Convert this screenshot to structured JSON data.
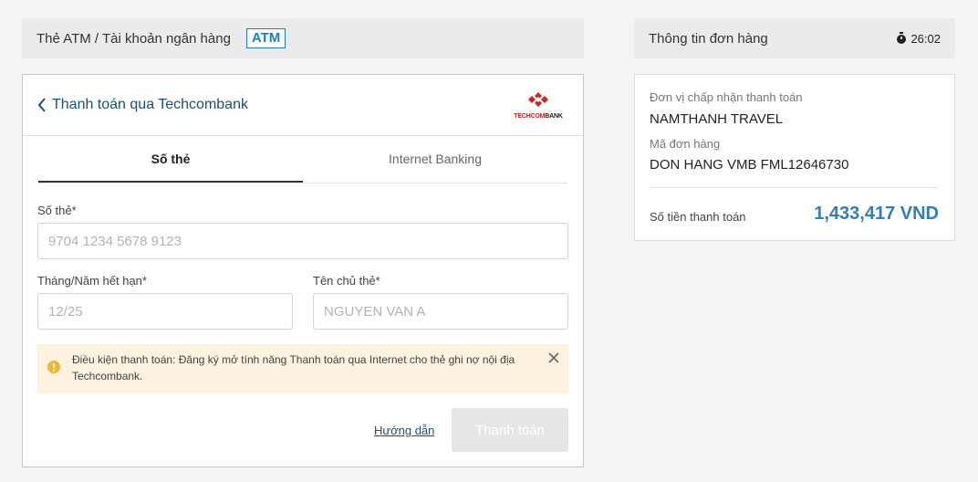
{
  "header": {
    "title": "Thẻ ATM / Tài khoản ngân hàng",
    "badge": "ATM"
  },
  "payment": {
    "back_label": "Thanh toán qua Techcombank",
    "bank_logo": {
      "text_red": "TECHCOM",
      "text_dark": "BANK",
      "color": "#d32020"
    },
    "tabs": [
      {
        "label": "Số thẻ",
        "active": true
      },
      {
        "label": "Internet Banking",
        "active": false
      }
    ],
    "fields": {
      "card_number": {
        "label": "Số thẻ*",
        "placeholder": "9704 1234 5678 9123",
        "value": ""
      },
      "expiry": {
        "label": "Tháng/Năm hết hạn*",
        "placeholder": "12/25",
        "value": ""
      },
      "holder": {
        "label": "Tên chủ thẻ*",
        "placeholder": "NGUYEN VAN A",
        "value": ""
      }
    },
    "notice": "Điều kiện thanh toán: Đăng ký mở tính năng Thanh toán qua Internet cho thẻ ghi nợ nội địa Techcombank.",
    "guide_label": "Hướng dẫn",
    "pay_label": "Thanh toán"
  },
  "order": {
    "title": "Thông tin đơn hàng",
    "timer": "26:02",
    "merchant_label": "Đơn vị chấp nhận thanh toán",
    "merchant_value": "NAMTHANH TRAVEL",
    "order_label": "Mã đơn hàng",
    "order_value": "DON HANG VMB FML12646730",
    "amount_label": "Số tiền thanh toán",
    "amount_value": "1,433,417 VND"
  },
  "colors": {
    "accent": "#1a7ec1",
    "link": "#1c4e80",
    "amount": "#2d7fc2",
    "notice_bg": "#fdf1df",
    "warning_icon": "#f3b72f"
  },
  "icons": {
    "back": "chevron-left-icon",
    "timer": "stopwatch-icon",
    "notice": "info-warning-icon",
    "close": "close-icon"
  }
}
